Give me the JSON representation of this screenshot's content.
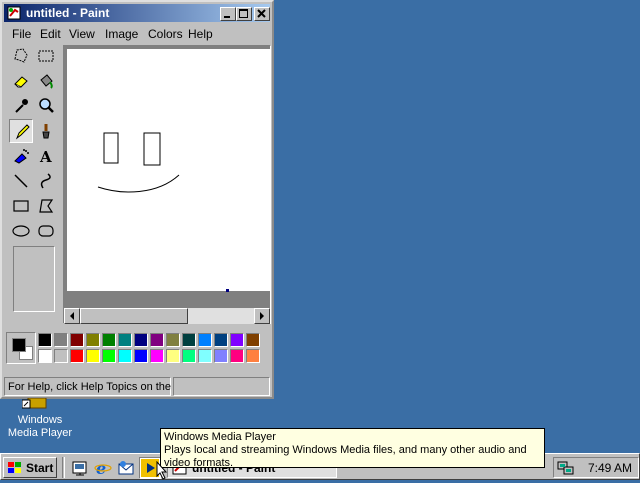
{
  "window": {
    "title": "untitled - Paint",
    "controls": {
      "minimize": "0",
      "maximize": "1",
      "close": "r"
    }
  },
  "menu": [
    {
      "label": "File"
    },
    {
      "label": "Edit"
    },
    {
      "label": "View"
    },
    {
      "label": "Image"
    },
    {
      "label": "Colors"
    },
    {
      "label": "Help"
    }
  ],
  "tools": [
    {
      "name": "free-form-select-icon"
    },
    {
      "name": "select-icon"
    },
    {
      "name": "eraser-icon"
    },
    {
      "name": "fill-icon"
    },
    {
      "name": "pick-color-icon"
    },
    {
      "name": "magnifier-icon"
    },
    {
      "name": "pencil-icon",
      "active": true
    },
    {
      "name": "brush-icon"
    },
    {
      "name": "airbrush-icon"
    },
    {
      "name": "text-icon",
      "glyph": "A"
    },
    {
      "name": "line-icon"
    },
    {
      "name": "curve-icon"
    },
    {
      "name": "rectangle-icon"
    },
    {
      "name": "polygon-icon"
    },
    {
      "name": "ellipse-icon"
    },
    {
      "name": "rounded-rectangle-icon"
    }
  ],
  "palette": {
    "foreground": "#000000",
    "background": "#ffffff",
    "row1": [
      "#000000",
      "#808080",
      "#800000",
      "#808000",
      "#008000",
      "#008080",
      "#000080",
      "#800080",
      "#808040",
      "#004040",
      "#0080ff",
      "#004080",
      "#8000ff",
      "#804000"
    ],
    "row2": [
      "#ffffff",
      "#c0c0c0",
      "#ff0000",
      "#ffff00",
      "#00ff00",
      "#00ffff",
      "#0000ff",
      "#ff00ff",
      "#ffff80",
      "#00ff80",
      "#80ffff",
      "#8080ff",
      "#ff0080",
      "#ff8040"
    ]
  },
  "status": {
    "help_text": "For Help, click Help Topics on the"
  },
  "desktop": {
    "icon_label_line1": "Windows",
    "icon_label_line2": "Media Player"
  },
  "tooltip": {
    "title": "Windows Media Player",
    "body": "Plays local and streaming Windows Media files, and many other audio and video formats."
  },
  "taskbar": {
    "start_label": "Start",
    "task_label": "untitled - Paint",
    "clock": "7:49 AM"
  },
  "colors": {
    "desktop": "#3a6ea5",
    "title_active": "#0a246a"
  }
}
